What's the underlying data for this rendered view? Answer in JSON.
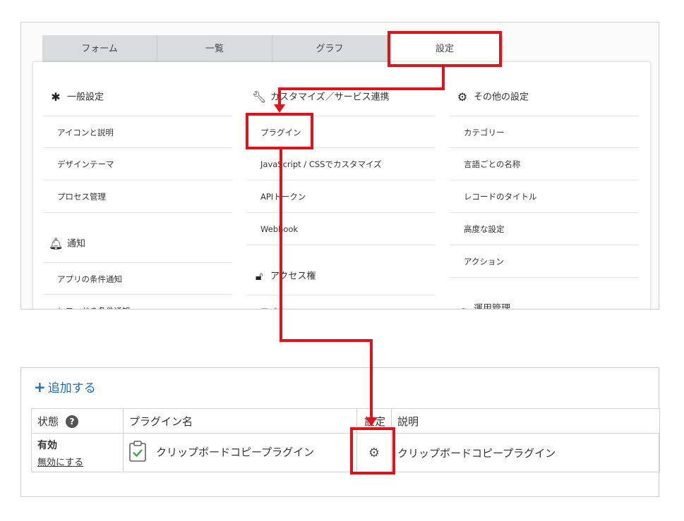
{
  "tabs": [
    {
      "label": "フォーム"
    },
    {
      "label": "一覧"
    },
    {
      "label": "グラフ"
    },
    {
      "label": "設定"
    }
  ],
  "settings": {
    "general": {
      "icon": "gear-icon",
      "title": "一般設定",
      "items": [
        "アイコンと説明",
        "デザインテーマ",
        "プロセス管理"
      ]
    },
    "notify": {
      "icon": "bell-icon",
      "title": "通知",
      "items": [
        "アプリの条件通知",
        "レコードの条件通知"
      ]
    },
    "customize": {
      "icon": "wrench-icon",
      "title": "カスタマイズ／サービス連携",
      "items": [
        "プラグイン",
        "JavaScript / CSSでカスタマイズ",
        "APIトークン",
        "Webhook"
      ]
    },
    "access": {
      "icon": "unlock-icon",
      "title": "アクセス権",
      "items": [
        "アプリ"
      ]
    },
    "other": {
      "icon": "gears-icon",
      "title": "その他の設定",
      "items": [
        "カテゴリー",
        "言語ごとの名称",
        "レコードのタイトル",
        "高度な設定",
        "アクション"
      ]
    },
    "operation": {
      "icon": "cloud-icon",
      "title": "運用管理"
    }
  },
  "plugins": {
    "add_label": "追加する",
    "headers": {
      "status": "状態",
      "name": "プラグイン名",
      "config": "設定",
      "desc": "説明"
    },
    "rows": [
      {
        "status": "有効",
        "toggle": "無効にする",
        "name": "クリップボードコピープラグイン",
        "desc": "クリップボードコピープラグイン"
      }
    ]
  },
  "colors": {
    "highlight": "#e0131a",
    "link": "#1b6fbd",
    "tab_bg": "#d9dbdc"
  }
}
